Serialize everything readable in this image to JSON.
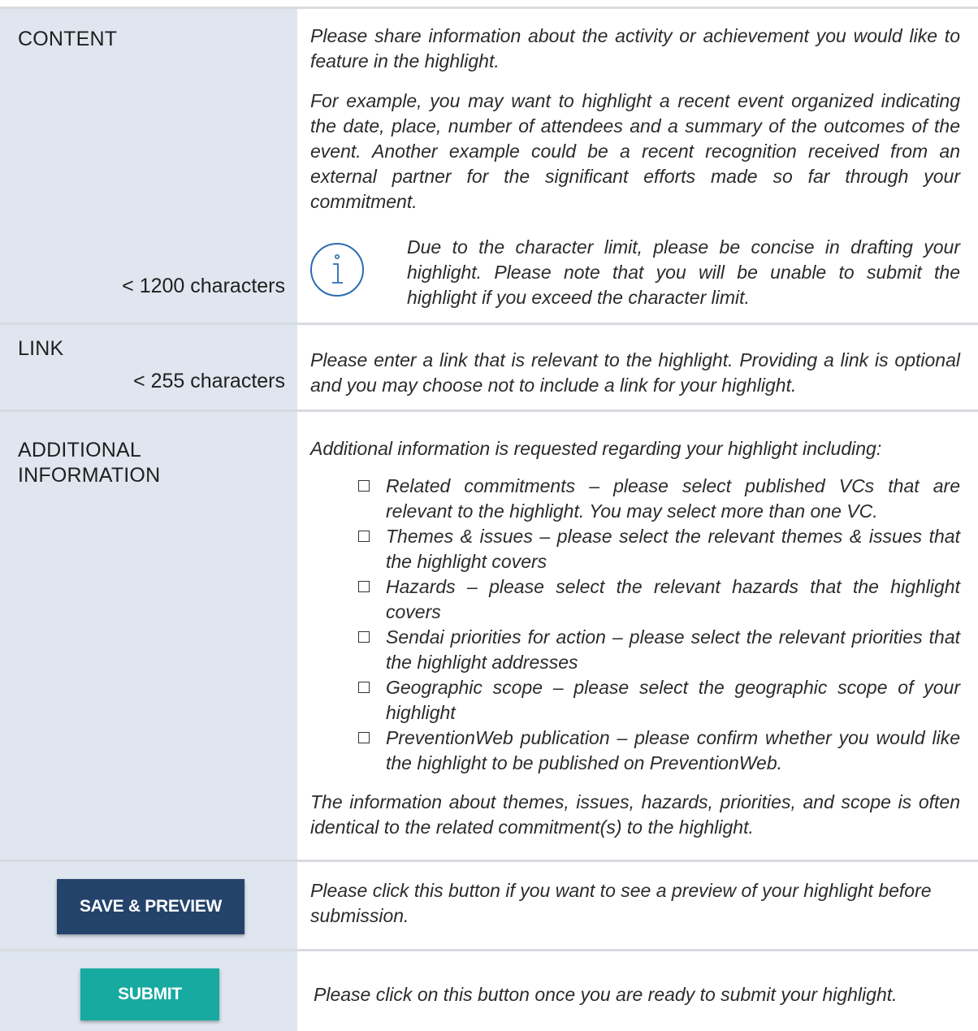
{
  "colors": {
    "left_column_bg": "#dfe6ef",
    "separator": "#d7dbe0",
    "save_preview_button": "#24436b",
    "submit_button": "#17aaa1",
    "info_icon": "#2b6cb0"
  },
  "content": {
    "label": "CONTENT",
    "limit": "< 1200 characters",
    "intro": "Please share information about the activity or achievement you would like to feature in the highlight.",
    "example": "For example, you may want to highlight a recent event organized indicating the date, place, number of attendees and a summary of the outcomes of the event. Another example could be a recent recognition received from an external partner for the significant efforts made so far through your commitment.",
    "icon": "info-icon",
    "note": "Due to the character limit, please be concise in drafting your highlight. Please note that you will be unable to submit the highlight if you exceed the character limit."
  },
  "link": {
    "label": "LINK",
    "limit": "< 255 characters",
    "description": "Please enter a link that is relevant to the highlight. Providing a link is optional and you may choose not to include a link for your highlight."
  },
  "additional": {
    "label_line1": "ADDITIONAL",
    "label_line2": "INFORMATION",
    "intro": "Additional information is requested regarding your highlight including:",
    "items": [
      "Related commitments – please select published VCs that are relevant to the highlight. You may select more than one VC.",
      "Themes & issues – please select the relevant themes & issues that the highlight covers",
      "Hazards – please select the relevant hazards that the highlight covers",
      "Sendai priorities for action – please select the relevant priorities that the highlight addresses",
      "Geographic scope – please select the geographic scope of your highlight",
      "PreventionWeb publication – please confirm whether you would like the highlight to be published on PreventionWeb."
    ],
    "footer": "The information about themes, issues, hazards, priorities, and scope is often identical to the related commitment(s) to the highlight."
  },
  "preview": {
    "button_label": "SAVE & PREVIEW",
    "description": "Please click this button if you want to see a preview of your highlight before submission."
  },
  "submit": {
    "button_label": "SUBMIT",
    "description": "Please click on this button once you are ready to submit your highlight."
  }
}
